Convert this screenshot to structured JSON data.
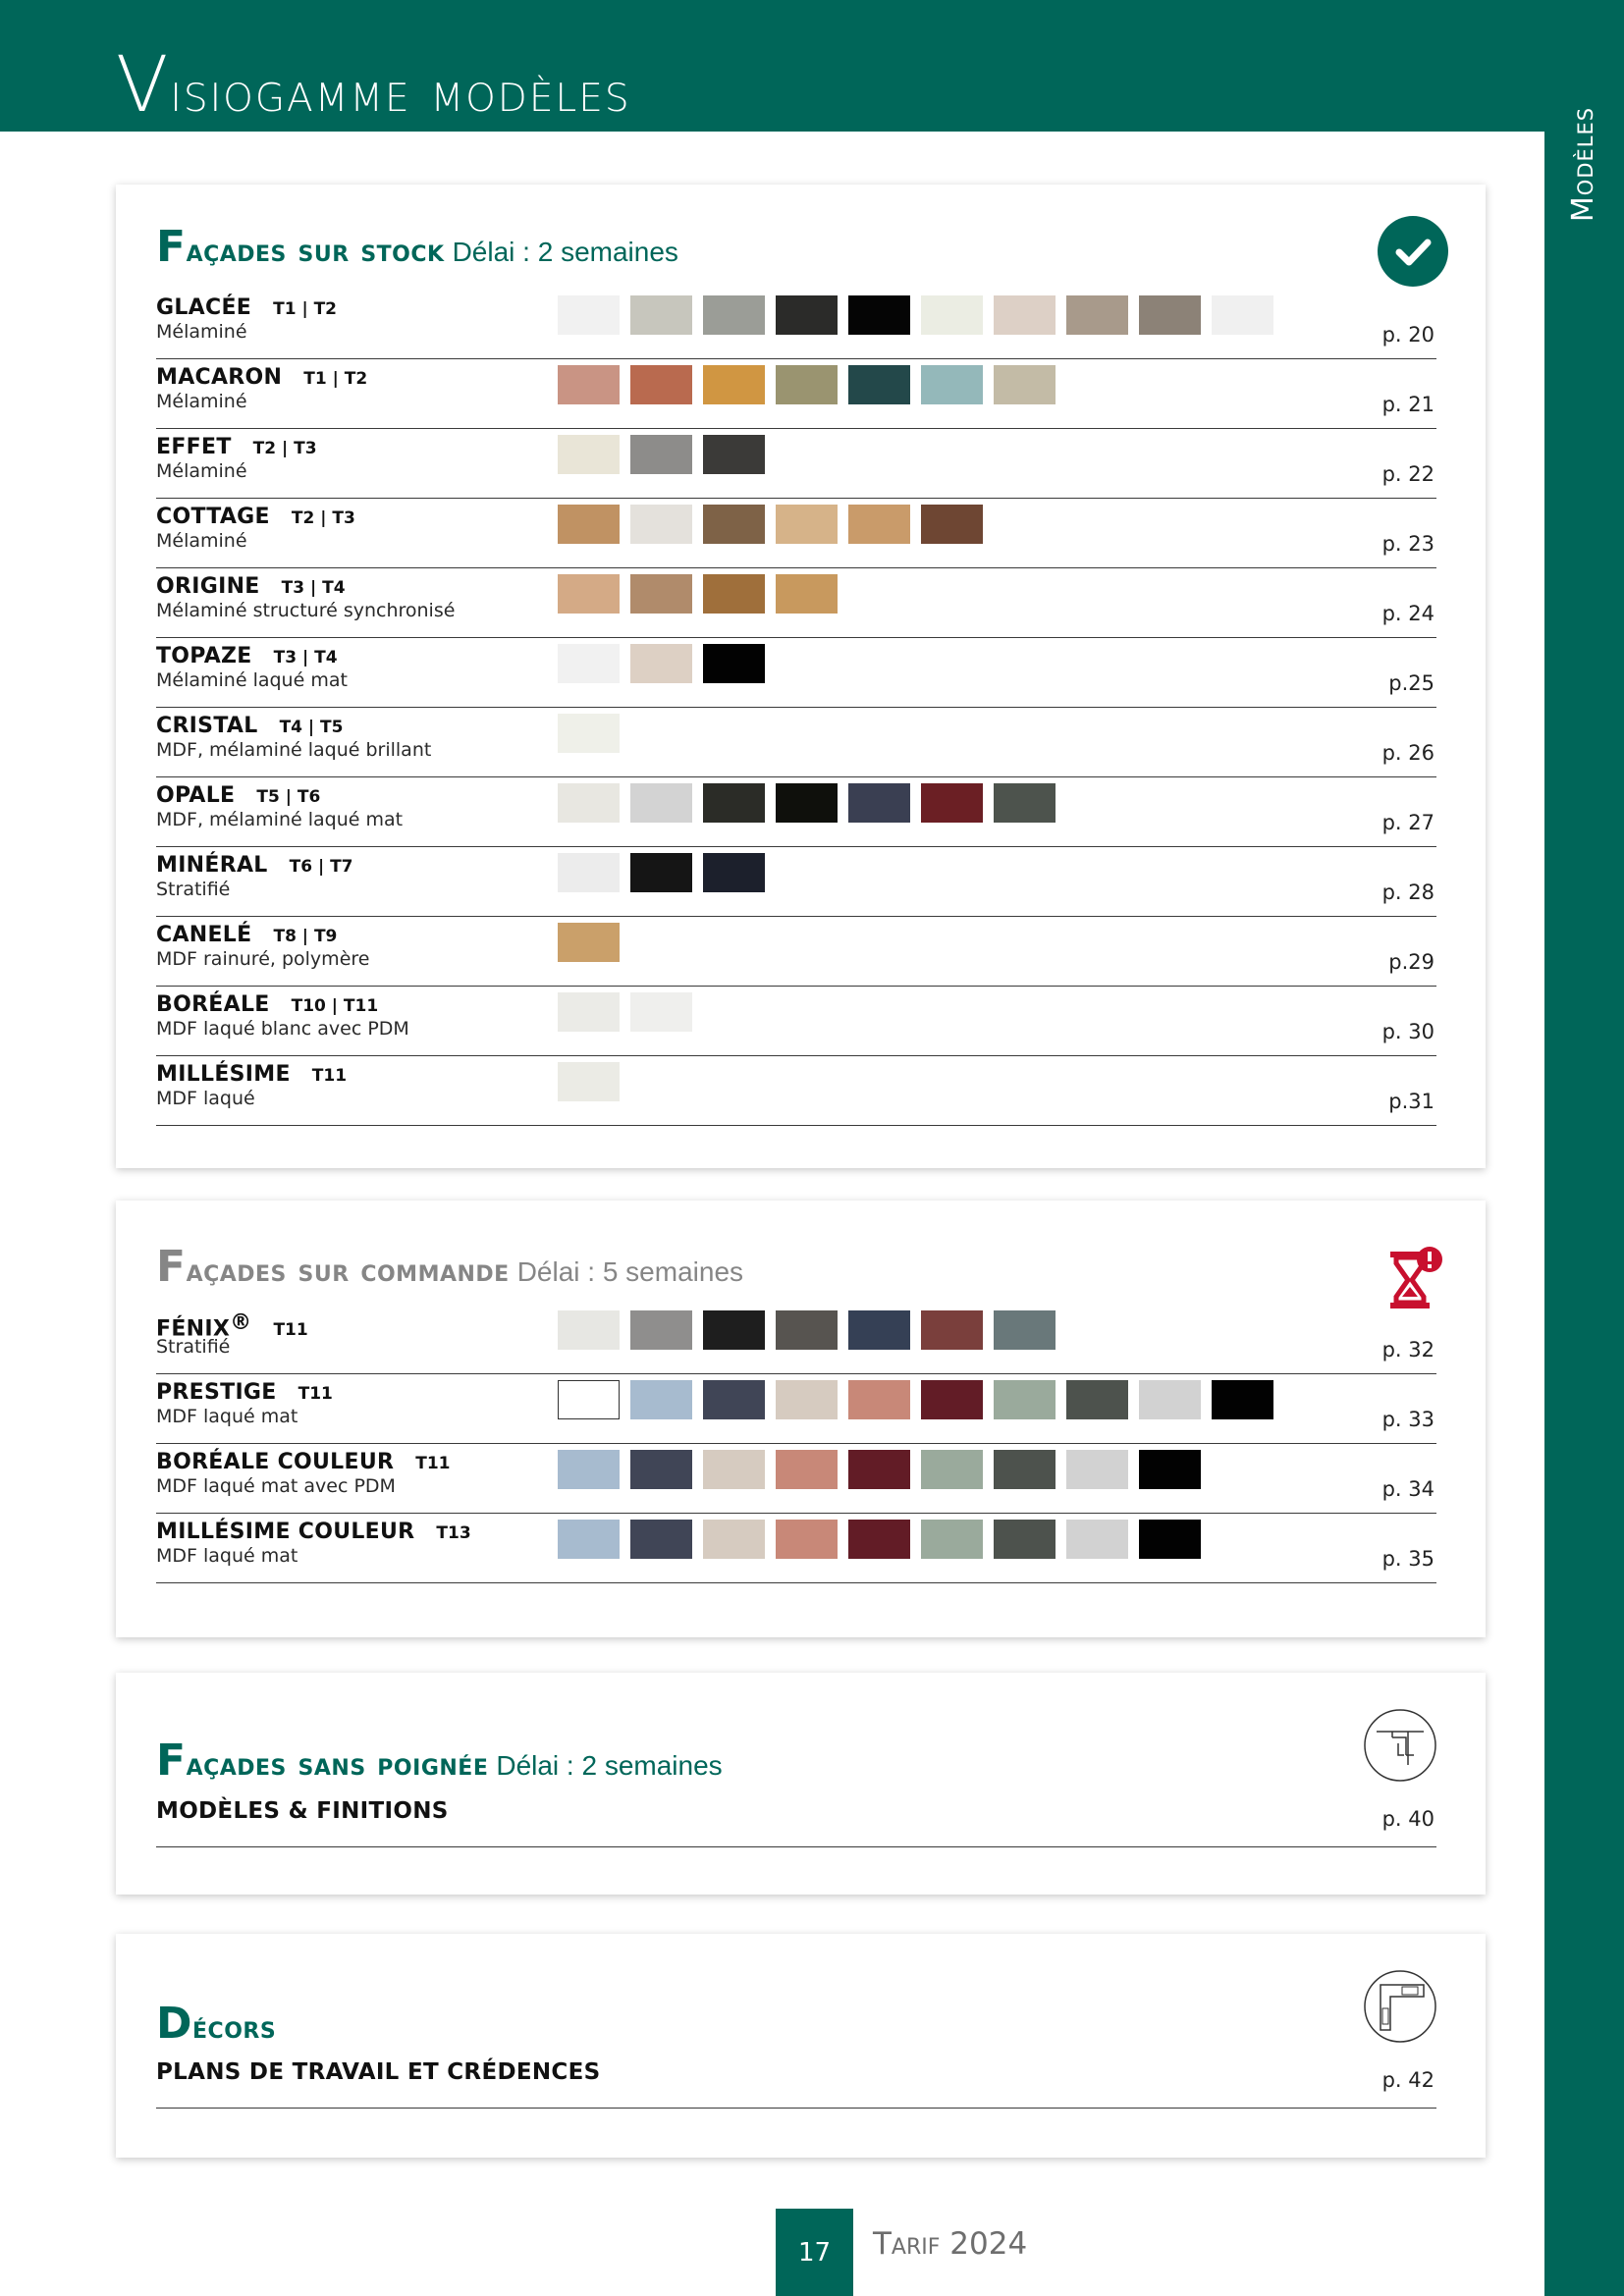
{
  "header": {
    "title_first": "V",
    "title_rest": "isiogamme modèles",
    "side_label": "Modèles"
  },
  "colors": {
    "brand_green": "#006659",
    "section_grey": "#868686",
    "alert_red": "#c8102e"
  },
  "sections": [
    {
      "title_first": "F",
      "title_rest": "açades sur stock",
      "delay": "Délai : 2 semaines",
      "icon": "check-circle-icon",
      "rows": [
        {
          "name": "GLACÉE",
          "tier": "T1 | T2",
          "material": "Mélaminé",
          "page": "p. 20",
          "swatches": [
            "#f1f1f1",
            "#c7c6bd",
            "#9b9d97",
            "#2b2b29",
            "#050505",
            "#ebede3",
            "#ddd0c6",
            "#a89a8b",
            "#8c8277",
            "#f0f0f0"
          ]
        },
        {
          "name": "MACARON",
          "tier": "T1 | T2",
          "material": "Mélaminé",
          "page": "p. 21",
          "swatches": [
            "#c99484",
            "#b96a4f",
            "#d09642",
            "#9a9470",
            "#23484a",
            "#94b8ba",
            "#c3bba6"
          ]
        },
        {
          "name": "EFFET",
          "tier": "T2 | T3",
          "material": "Mélaminé",
          "page": "p. 22",
          "swatches": [
            "#e9e5d7",
            "#8d8c8a",
            "#3b3a38"
          ]
        },
        {
          "name": "COTTAGE",
          "tier": "T2 | T3",
          "material": "Mélaminé",
          "page": "p. 23",
          "swatches": [
            "#c09263",
            "#e4e1dc",
            "#7e6247",
            "#d6b389",
            "#c99b6a",
            "#6e4633"
          ]
        },
        {
          "name": "ORIGINE",
          "tier": "T3 | T4",
          "material": "Mélaminé structuré synchronisé",
          "page": "p. 24",
          "swatches": [
            "#d4aa86",
            "#b08b6b",
            "#9f6f3b",
            "#c8995e"
          ]
        },
        {
          "name": "TOPAZE",
          "tier": "T3 | T4",
          "material": "Mélaminé laqué mat",
          "page": "p.25",
          "swatches": [
            "#f1f1f1",
            "#ddd0c4",
            "#020202"
          ]
        },
        {
          "name": "CRISTAL",
          "tier": "T4 | T5",
          "material": "MDF, mélaminé laqué brillant",
          "page": "p. 26",
          "swatches": [
            "#eff0e9"
          ]
        },
        {
          "name": "OPALE",
          "tier": "T5 | T6",
          "material": "MDF, mélaminé laqué mat",
          "page": "p. 27",
          "swatches": [
            "#e8e7e1",
            "#d3d3d3",
            "#2b2c27",
            "#0f100c",
            "#3a3f52",
            "#6b1f24",
            "#4d534d"
          ]
        },
        {
          "name": "MINÉRAL",
          "tier": "T6 | T7",
          "material": "Stratifié",
          "page": "p. 28",
          "swatches": [
            "#ececec",
            "#151515",
            "#1c202c"
          ]
        },
        {
          "name": "CANELÉ",
          "tier": "T8 | T9",
          "material": "MDF rainuré, polymère",
          "page": "p.29",
          "swatches": [
            "#caa06a"
          ]
        },
        {
          "name": "BORÉALE",
          "tier": "T10 | T11",
          "material": "MDF laqué blanc avec PDM",
          "page": "p. 30",
          "swatches": [
            "#ebebe7",
            "#efefed"
          ]
        },
        {
          "name": "MILLÉSIME",
          "tier": "T11",
          "material": "MDF laqué",
          "page": "p.31",
          "swatches": [
            "#ebebe5"
          ]
        }
      ]
    },
    {
      "title_first": "F",
      "title_rest": "açades sur commande",
      "delay": "Délai : 5 semaines",
      "icon": "hourglass-alert-icon",
      "rows": [
        {
          "name": "FÉNIX",
          "sup": "®",
          "tier": "T11",
          "material": "Stratifié",
          "page": "p. 32",
          "swatches": [
            "#e7e7e3",
            "#8f8e8d",
            "#1e1e1e",
            "#575450",
            "#354055",
            "#7a3f3c",
            "#69787a"
          ]
        },
        {
          "name": "PRESTIGE",
          "tier": "T11",
          "material": "MDF laqué mat",
          "page": "p. 33",
          "swatches": [
            "#ffffff",
            "#a7bbcf",
            "#404556",
            "#d6cbc0",
            "#c88878",
            "#621c26",
            "#9aaa9c",
            "#4d524d",
            "#d2d2d2",
            "#020202"
          ]
        },
        {
          "name": "BORÉALE COULEUR",
          "tier": "T11",
          "material": "MDF laqué mat avec PDM",
          "page": "p. 34",
          "swatches": [
            "#a7bbcf",
            "#404556",
            "#d6cbc0",
            "#c88878",
            "#621c26",
            "#9aaa9c",
            "#4d524d",
            "#d2d2d2",
            "#020202"
          ]
        },
        {
          "name": "MILLÉSIME COULEUR",
          "tier": "T13",
          "material": "MDF laqué mat",
          "page": "p. 35",
          "swatches": [
            "#a7bbcf",
            "#404556",
            "#d6cbc0",
            "#c88878",
            "#621c26",
            "#9aaa9c",
            "#4d524d",
            "#d2d2d2",
            "#020202"
          ]
        }
      ]
    },
    {
      "title_first": "F",
      "title_rest": "açades sans poignée",
      "delay": "Délai : 2 semaines",
      "icon": "handleless-profile-icon",
      "rows": [
        {
          "name": "MODÈLES & FINITIONS",
          "page": "p. 40"
        }
      ]
    },
    {
      "title_first": "D",
      "title_rest": "écors",
      "delay": "",
      "icon": "kitchen-layout-icon",
      "rows": [
        {
          "name": "PLANS DE TRAVAIL ET CRÉDENCES",
          "page": "p. 42"
        }
      ]
    }
  ],
  "footer": {
    "page_number": "17",
    "tarif": "Tarif 2024"
  }
}
